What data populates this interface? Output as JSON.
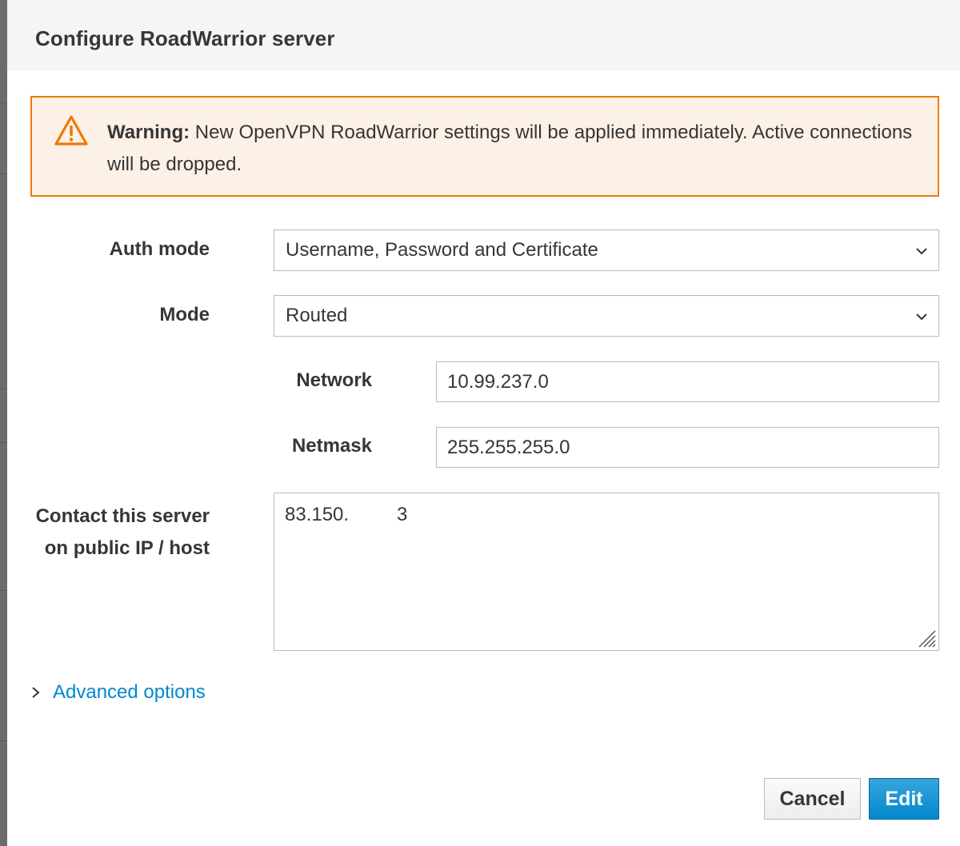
{
  "dialog": {
    "title": "Configure RoadWarrior server"
  },
  "warning": {
    "icon": "warning-triangle-icon",
    "prefix": "Warning:",
    "message": "New OpenVPN RoadWarrior settings will be applied immediately. Active connections will be dropped.",
    "color": "#ec7a08"
  },
  "form": {
    "auth_mode": {
      "label": "Auth mode",
      "value": "Username, Password and Certificate"
    },
    "mode": {
      "label": "Mode",
      "value": "Routed"
    },
    "network": {
      "label": "Network",
      "value": "10.99.237.0"
    },
    "netmask": {
      "label": "Netmask",
      "value": "255.255.255.0"
    },
    "public_host": {
      "label_line1": "Contact this server",
      "label_line2": "on public IP / host",
      "value_visible_start": "83.150.",
      "value_visible_end": "3"
    }
  },
  "advanced": {
    "label": "Advanced options"
  },
  "footer": {
    "cancel_label": "Cancel",
    "edit_label": "Edit"
  },
  "colors": {
    "accent": "#0088ce",
    "primary_button": "#0088ce",
    "header_bg": "#f5f5f5",
    "warning_bg": "#fcf1e6"
  }
}
